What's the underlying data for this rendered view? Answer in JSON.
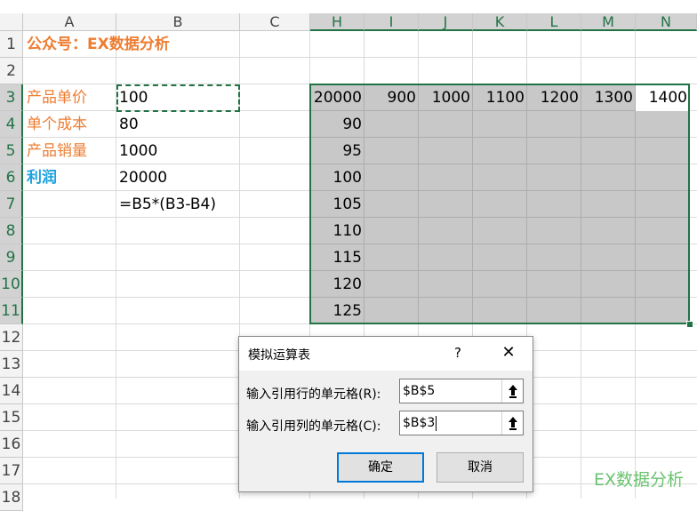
{
  "columns": [
    "A",
    "B",
    "C",
    "H",
    "I",
    "J",
    "K",
    "L",
    "M",
    "N"
  ],
  "rows": [
    "1",
    "2",
    "3",
    "4",
    "5",
    "6",
    "7",
    "8",
    "9",
    "10",
    "11",
    "12",
    "13",
    "14",
    "15",
    "16",
    "17",
    "18"
  ],
  "cells": {
    "a1": "公众号：EX数据分析",
    "a3": "产品单价",
    "b3": "100",
    "a4": "单个成本",
    "b4": "80",
    "a5": "产品销量",
    "b5": "1000",
    "a6": "利润",
    "b6": "20000",
    "b7": "=B5*(B3-B4)"
  },
  "data_table": {
    "corner": "20000",
    "row_input_values": [
      "900",
      "1000",
      "1100",
      "1200",
      "1300",
      "1400"
    ],
    "column_input_values": [
      "90",
      "95",
      "100",
      "105",
      "110",
      "115",
      "120",
      "125"
    ]
  },
  "dialog": {
    "title": "模拟运算表",
    "help": "?",
    "close": "✕",
    "row_input_label": "输入引用行的单元格(R):",
    "row_input_value": "$B$5",
    "col_input_label": "输入引用列的单元格(C):",
    "col_input_value": "$B$3",
    "ok_label": "确定",
    "cancel_label": "取消"
  },
  "watermark": "EX数据分析",
  "colors": {
    "accent_green": "#217346",
    "label_orange": "#ed7d31",
    "profit_blue": "#1ba1e2",
    "table_grey": "#c8c8c8"
  },
  "icons": {
    "collapse_dialog": "upload-arrow-icon",
    "close": "close-icon"
  }
}
